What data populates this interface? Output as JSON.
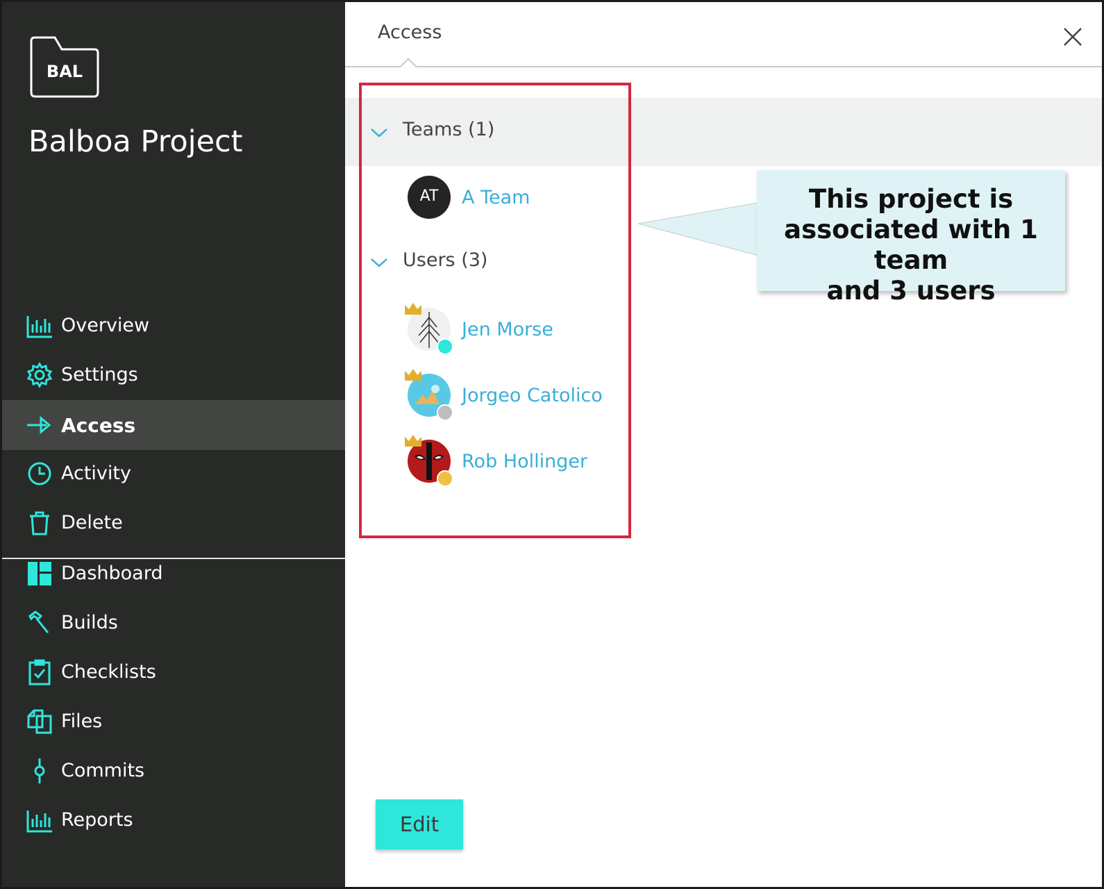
{
  "sidebar": {
    "project_code": "BAL",
    "project_name": "Balboa Project",
    "items": [
      {
        "label": "Overview",
        "icon": "bar-chart-icon"
      },
      {
        "label": "Settings",
        "icon": "gear-icon"
      },
      {
        "label": "Access",
        "icon": "arrow-right-icon"
      },
      {
        "label": "Activity",
        "icon": "clock-icon"
      },
      {
        "label": "Delete",
        "icon": "trash-icon"
      },
      {
        "label": "Dashboard",
        "icon": "dashboard-icon"
      },
      {
        "label": "Builds",
        "icon": "hammer-icon"
      },
      {
        "label": "Checklists",
        "icon": "clipboard-check-icon"
      },
      {
        "label": "Files",
        "icon": "files-icon"
      },
      {
        "label": "Commits",
        "icon": "commit-icon"
      },
      {
        "label": "Reports",
        "icon": "bar-chart-icon"
      }
    ],
    "active": "Access"
  },
  "main": {
    "tab": "Access",
    "teams_title": "Teams (1)",
    "teams": [
      {
        "initials": "AT",
        "name": "A Team"
      }
    ],
    "users_title": "Users (3)",
    "users": [
      {
        "name": "Jen Morse",
        "status_color": "#2ee6da"
      },
      {
        "name": "Jorgeo Catolico",
        "status_color": "#bdbdbd"
      },
      {
        "name": "Rob Hollinger",
        "status_color": "#f2c040"
      }
    ],
    "edit_label": "Edit"
  },
  "callout": {
    "line1": "This project is",
    "line2": "associated with 1 team",
    "line3": "and 3 users"
  },
  "colors": {
    "sidebar_bg": "#282a28",
    "accent": "#2ee6da",
    "link": "#3aaed8",
    "highlight": "#d62640",
    "callout_bg": "#dff3f6"
  }
}
